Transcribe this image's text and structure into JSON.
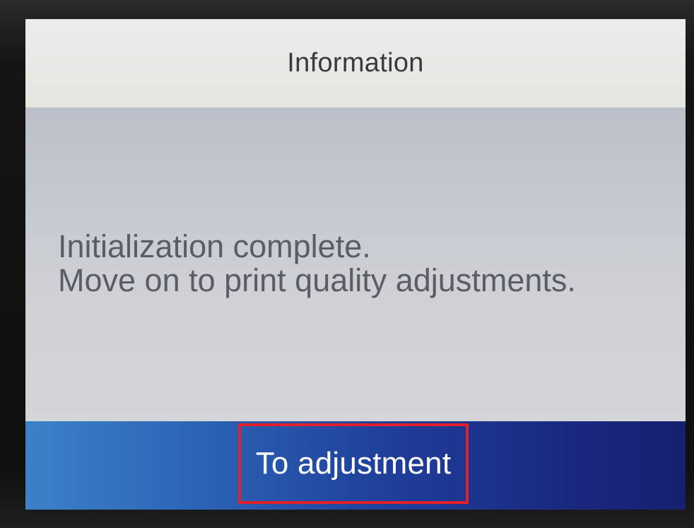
{
  "dialog": {
    "title": "Information",
    "message_lines": [
      "Initialization complete.",
      "Move on to print quality adjustments."
    ],
    "action_button_label": "To adjustment"
  },
  "colors": {
    "highlight_box": "#e0202a",
    "action_bar_start": "#3b82c9",
    "action_bar_end": "#16206f",
    "header_background": "#e5e5e2"
  }
}
